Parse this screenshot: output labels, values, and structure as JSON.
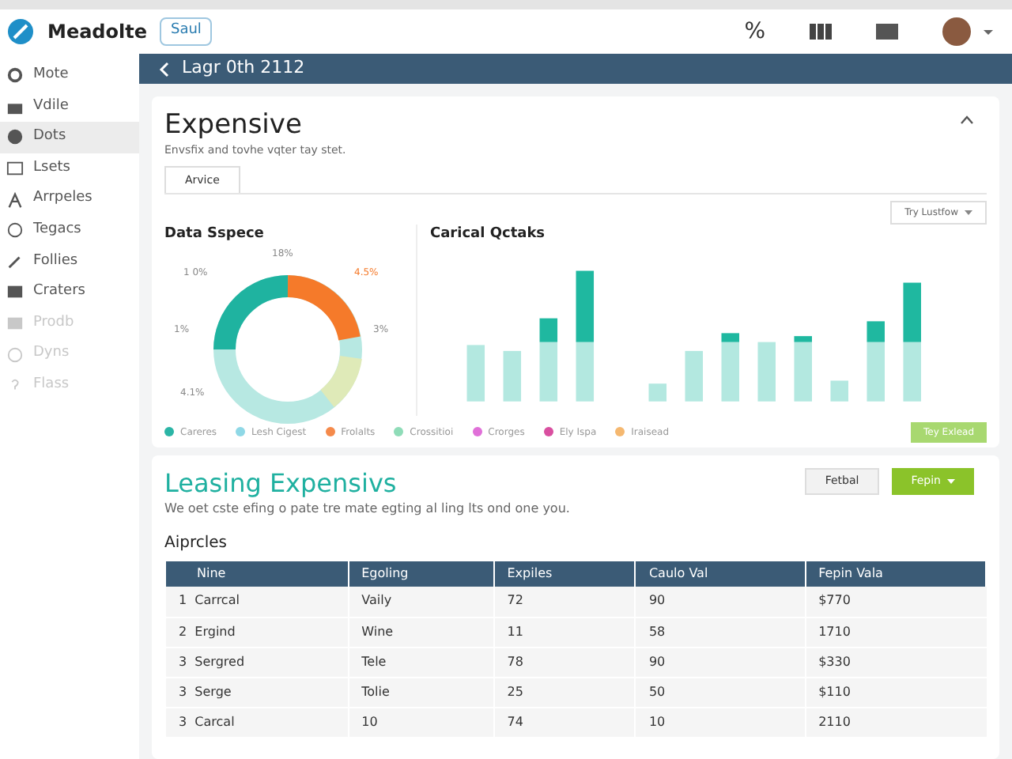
{
  "app": {
    "name": "Meadolte",
    "badge": "Saul",
    "toolbar_glyph": "%"
  },
  "sidebar": {
    "items": [
      {
        "label": "Mote",
        "selected": false,
        "disabled": false
      },
      {
        "label": "Vdile",
        "selected": false,
        "disabled": false
      },
      {
        "label": "Dots",
        "selected": true,
        "disabled": false
      },
      {
        "label": "Lsets",
        "selected": false,
        "disabled": false
      },
      {
        "label": "Arrpeles",
        "selected": false,
        "disabled": false
      },
      {
        "label": "Tegacs",
        "selected": false,
        "disabled": false
      },
      {
        "label": "Follies",
        "selected": false,
        "disabled": false
      },
      {
        "label": "Craters",
        "selected": false,
        "disabled": false
      },
      {
        "label": "Prodb",
        "selected": false,
        "disabled": true
      },
      {
        "label": "Dyns",
        "selected": false,
        "disabled": true
      },
      {
        "label": "Flass",
        "selected": false,
        "disabled": true
      }
    ]
  },
  "header": {
    "title": "Lagr 0th 2112"
  },
  "overview": {
    "title": "Expensive",
    "subtitle": "Envsfix and tovhe vqter tay stet.",
    "tabs": [
      {
        "label": "Arvice",
        "selected": true
      }
    ],
    "dropdown": "Try Lustfow",
    "donut": {
      "title": "Data Sspece",
      "labels": [
        "18%",
        "1 0%",
        "4.5%",
        "1%",
        "3%",
        "4.1%"
      ]
    },
    "bars": {
      "title": "Carical Qctaks"
    },
    "legend": [
      {
        "label": "Careres",
        "color": "#2bb5a6"
      },
      {
        "label": "Lesh Cigest",
        "color": "#8fd8e6"
      },
      {
        "label": "Frolalts",
        "color": "#f58a4b"
      },
      {
        "label": "Crossitioi",
        "color": "#8fdcb8"
      },
      {
        "label": "Crorges",
        "color": "#e070d8"
      },
      {
        "label": "Ely Ispa",
        "color": "#d94fa0"
      },
      {
        "label": "Iraisead",
        "color": "#f5b870"
      }
    ],
    "action": "Tey Exlead"
  },
  "leasing": {
    "title": "Leasing Expensivs",
    "subtitle": "We oet cste efing o pate tre mate egting al ling lts ond one you.",
    "buttons": [
      {
        "label": "Fetbal",
        "kind": "plain"
      },
      {
        "label": "Fepin",
        "kind": "primary"
      }
    ],
    "section": "Aiprcles",
    "table": {
      "columns": [
        "Nine",
        "Egoling",
        "Expiles",
        "Caulo Val",
        "Fepin Vala"
      ],
      "rows": [
        [
          "1  Carrcal",
          "Vaily",
          "72",
          "90",
          "$770"
        ],
        [
          "2  Ergind",
          "Wine",
          "11",
          "58",
          "1710"
        ],
        [
          "3  Sergred",
          "Tele",
          "78",
          "90",
          "$330"
        ],
        [
          "3  Serge",
          "Tolie",
          "25",
          "50",
          "$110"
        ],
        [
          "3  Carcal",
          "10",
          "74",
          "10",
          "2110"
        ]
      ]
    }
  }
}
